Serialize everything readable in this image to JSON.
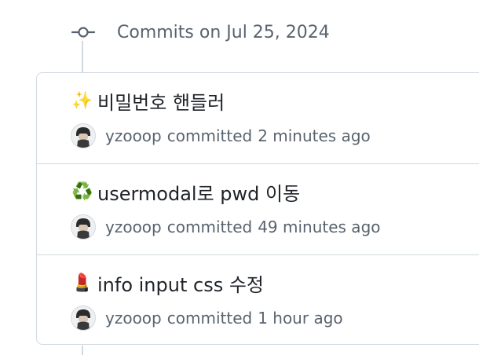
{
  "group": {
    "title": "Commits on Jul 25, 2024",
    "icon": "git-commit-icon"
  },
  "commits": [
    {
      "emoji": "✨",
      "emoji_name": "sparkles-icon",
      "message": "비밀번호 핸들러",
      "author": "yzooop",
      "action": "committed",
      "time": "2 minutes ago"
    },
    {
      "emoji": "♻️",
      "emoji_name": "recycle-icon",
      "message": "usermodal로 pwd 이동",
      "author": "yzooop",
      "action": "committed",
      "time": "49 minutes ago"
    },
    {
      "emoji": "💄",
      "emoji_name": "lipstick-icon",
      "message": "info input css 수정",
      "author": "yzooop",
      "action": "committed",
      "time": "1 hour ago"
    }
  ],
  "colors": {
    "border": "#d1d9e0",
    "muted_text": "#59636e",
    "text": "#1f2328"
  }
}
